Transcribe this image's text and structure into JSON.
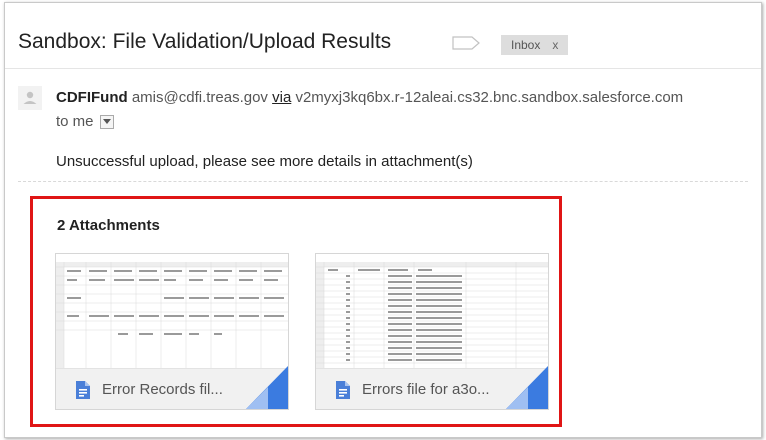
{
  "email": {
    "subject": "Sandbox: File Validation/Upload Results",
    "label_chip": "Inbox",
    "label_chip_close": "x",
    "sender_name": "CDFIFund",
    "sender_email": "amis@cdfi.treas.gov",
    "via_label": "via",
    "via_host": "v2myxj3kq6bx.r-12aleai.cs32.bnc.sandbox.salesforce.com",
    "to_label": "to me",
    "body": "Unsuccessful upload, please see more details in attachment(s)"
  },
  "attachments": {
    "title": "2 Attachments",
    "items": [
      {
        "name": "Error Records fil..."
      },
      {
        "name": "Errors file for a3o..."
      }
    ]
  },
  "colors": {
    "highlight_border": "#e01515",
    "doc_icon": "#4a7fd8",
    "fold_blue": "#3b7be0"
  }
}
